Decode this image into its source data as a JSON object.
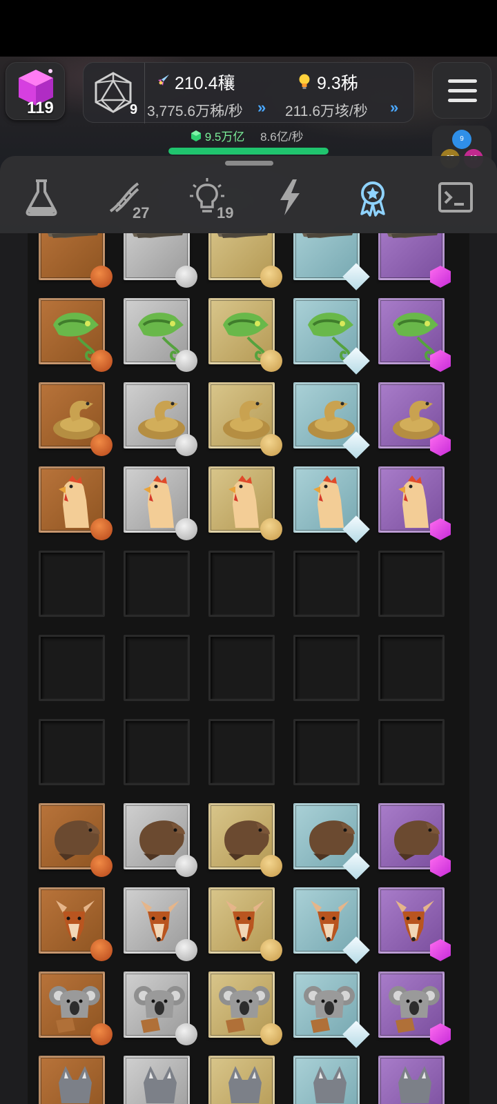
{
  "header": {
    "cube_count": "119",
    "d20_level": "9",
    "resource1_value": "210.4穰",
    "resource1_rate": "3,775.6万秭/秒",
    "resource2_value": "9.3秭",
    "resource2_rate": "211.6万垓/秒",
    "gem_value": "9.5万亿",
    "gem_rate": "8.6亿/秒",
    "gem_progress": 1.0,
    "orbs": {
      "blue": "9",
      "gold": "27",
      "pink": "19"
    }
  },
  "tabs": [
    {
      "name": "lab-flask",
      "count": ""
    },
    {
      "name": "dna",
      "count": "27"
    },
    {
      "name": "idea-bulb",
      "count": "19"
    },
    {
      "name": "lightning",
      "count": ""
    },
    {
      "name": "achievements-badge",
      "count": "",
      "active": true
    },
    {
      "name": "terminal",
      "count": ""
    }
  ],
  "tiers": [
    "bronze",
    "silver",
    "gold",
    "diamond",
    "amethyst"
  ],
  "grid_rows": [
    {
      "animal": "crocodile",
      "filled": true
    },
    {
      "animal": "chameleon",
      "filled": true
    },
    {
      "animal": "snake",
      "filled": true
    },
    {
      "animal": "chicken",
      "filled": true
    },
    {
      "animal": "",
      "filled": false
    },
    {
      "animal": "",
      "filled": false
    },
    {
      "animal": "",
      "filled": false
    },
    {
      "animal": "beaver",
      "filled": true
    },
    {
      "animal": "deer",
      "filled": true
    },
    {
      "animal": "koala",
      "filled": true
    },
    {
      "animal": "wolf",
      "filled": true
    }
  ],
  "colors": {
    "accent_green": "#20c46e",
    "accent_blue": "#4aa8ff",
    "active_tab": "#8fd3ff"
  }
}
